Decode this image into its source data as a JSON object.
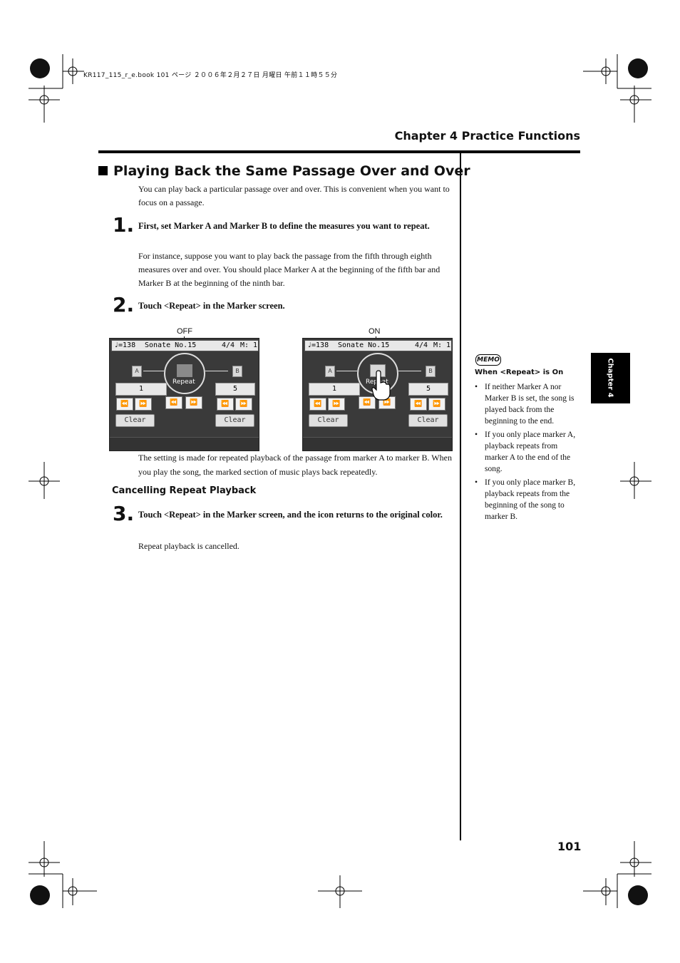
{
  "header": {
    "file_info": "KR117_115_r_e.book  101 ページ  ２００６年２月２７日  月曜日  午前１１時５５分",
    "chapter_title": "Chapter 4 Practice Functions"
  },
  "section": {
    "title": "Playing Back the Same Passage Over and Over",
    "intro": "You can play back a particular passage over and over. This is convenient when you want to focus on a passage."
  },
  "steps": [
    {
      "number": "1.",
      "instruction": "First, set Marker A and Marker B to define the measures you want to repeat.",
      "detail": "For instance, suppose you want to play back the passage from the fifth through eighth measures over and over. You should place Marker A at the beginning of the fifth bar and Marker B at the beginning of the ninth bar."
    },
    {
      "number": "2.",
      "instruction": "Touch <Repeat> in the Marker screen."
    },
    {
      "number": "3.",
      "instruction": "Touch <Repeat> in the Marker screen, and the icon returns to the original color.",
      "detail": "Repeat playback is cancelled."
    }
  ],
  "screens": {
    "off_label": "OFF",
    "on_label": "ON",
    "tempo": "♩=138",
    "song": "Sonate No.15",
    "time_sig": "4/4",
    "measure": "M:  1",
    "marker_a": "A",
    "marker_b": "B",
    "marker_a_value": "1",
    "marker_b_value": "5",
    "repeat_label": "Repeat",
    "clear_label": "Clear",
    "rewind_icon": "⏪",
    "forward_icon": "⏩"
  },
  "caption": "The setting is made for repeated playback of the passage from marker A to marker B. When you play the song, the marked section of music plays back repeatedly.",
  "cancel_heading": "Cancelling Repeat Playback",
  "memo": {
    "badge": "MEMO",
    "heading": "When <Repeat> is On",
    "items": [
      "If neither Marker A nor Marker B is set, the song is played back from the beginning to the end.",
      "If you only place marker A, playback repeats from marker A to the end of the song.",
      "If you only place marker B, playback repeats from the beginning of the song to marker B."
    ]
  },
  "side_tab": "Chapter 4",
  "page_number": "101"
}
